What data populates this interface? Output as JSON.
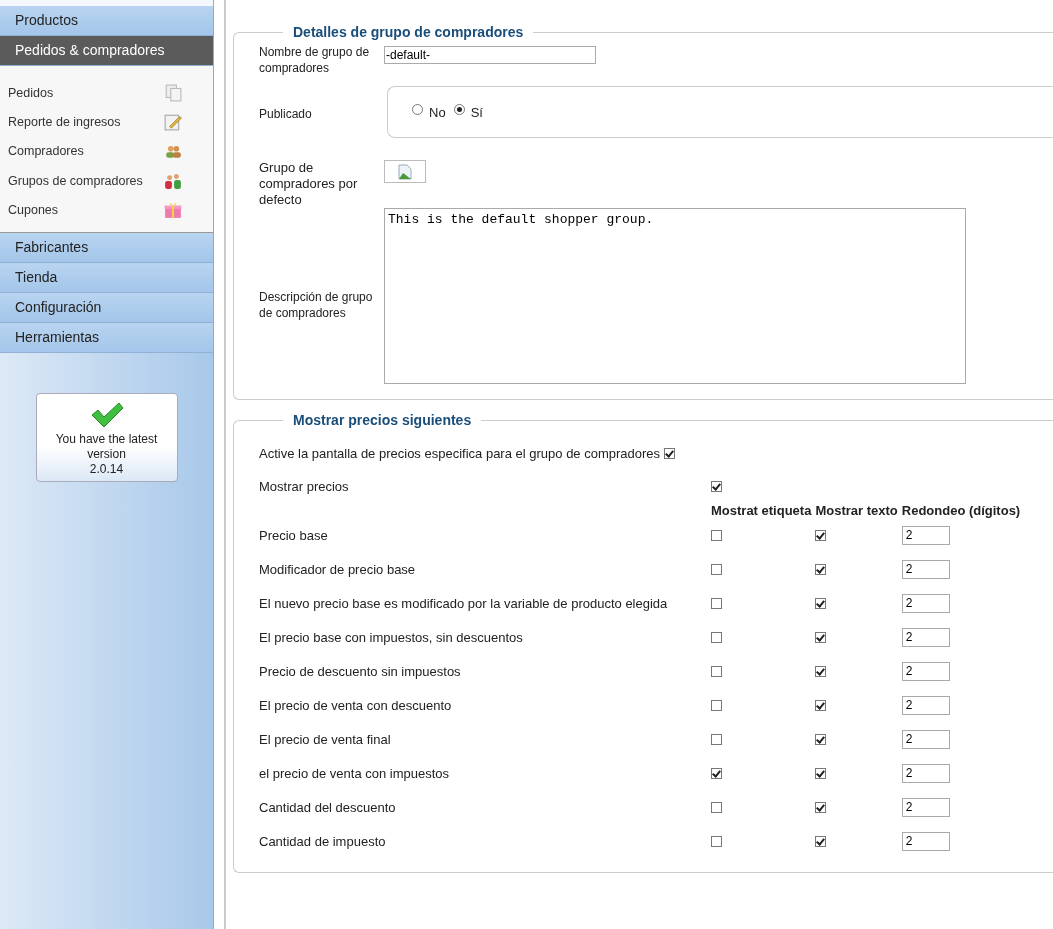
{
  "sidebar": {
    "sections": [
      {
        "label": "Productos",
        "selected": false
      },
      {
        "label": "Pedidos & compradores",
        "selected": true,
        "items": [
          {
            "label": "Pedidos",
            "kind": "documents"
          },
          {
            "label": "Reporte de ingresos",
            "kind": "edit"
          },
          {
            "label": "Compradores",
            "kind": "people"
          },
          {
            "label": "Grupos de compradores",
            "kind": "group"
          },
          {
            "label": "Cupones",
            "kind": "gift"
          }
        ]
      },
      {
        "label": "Fabricantes",
        "selected": false
      },
      {
        "label": "Tienda",
        "selected": false
      },
      {
        "label": "Configuración",
        "selected": false
      },
      {
        "label": "Herramientas",
        "selected": false
      }
    ],
    "version_box": {
      "message": "You have the latest version",
      "version": "2.0.14"
    }
  },
  "details": {
    "legend": "Detalles de grupo de compradores",
    "name_label": "Nombre de grupo de compradores",
    "name_value": "-default-",
    "published_label": "Publicado",
    "published_options": [
      {
        "label": "No",
        "selected": false
      },
      {
        "label": "Sí",
        "selected": true
      }
    ],
    "default_label": "Grupo de compradores por defecto",
    "description_label": "Descripción de grupo de compradores",
    "description_value": "This is the default shopper group."
  },
  "prices": {
    "legend": "Mostrar precios siguientes",
    "enable_label": "Active la pantalla de precios especifica para el grupo de compradores",
    "enable_checked": true,
    "show_label": "Mostrar precios",
    "show_checked": true,
    "columns": [
      "Mostrat etiqueta",
      "Mostrar texto",
      "Redondeo (dígitos)"
    ],
    "rows": [
      {
        "label": "Precio base",
        "show_label": false,
        "show_text": true,
        "rounding": "2"
      },
      {
        "label": "Modificador de precio base",
        "show_label": false,
        "show_text": true,
        "rounding": "2"
      },
      {
        "label": "El nuevo precio base es modificado por la variable de producto elegida",
        "show_label": false,
        "show_text": true,
        "rounding": "2"
      },
      {
        "label": "El precio base con impuestos, sin descuentos",
        "show_label": false,
        "show_text": true,
        "rounding": "2"
      },
      {
        "label": "Precio de descuento sin impuestos",
        "show_label": false,
        "show_text": true,
        "rounding": "2"
      },
      {
        "label": "El precio de venta con descuento",
        "show_label": false,
        "show_text": true,
        "rounding": "2"
      },
      {
        "label": "El precio de venta final",
        "show_label": false,
        "show_text": true,
        "rounding": "2"
      },
      {
        "label": "el precio de venta con impuestos",
        "show_label": true,
        "show_text": true,
        "rounding": "2"
      },
      {
        "label": "Cantidad del descuento",
        "show_label": false,
        "show_text": true,
        "rounding": "2"
      },
      {
        "label": "Cantidad de impuesto",
        "show_label": false,
        "show_text": true,
        "rounding": "2"
      }
    ]
  }
}
